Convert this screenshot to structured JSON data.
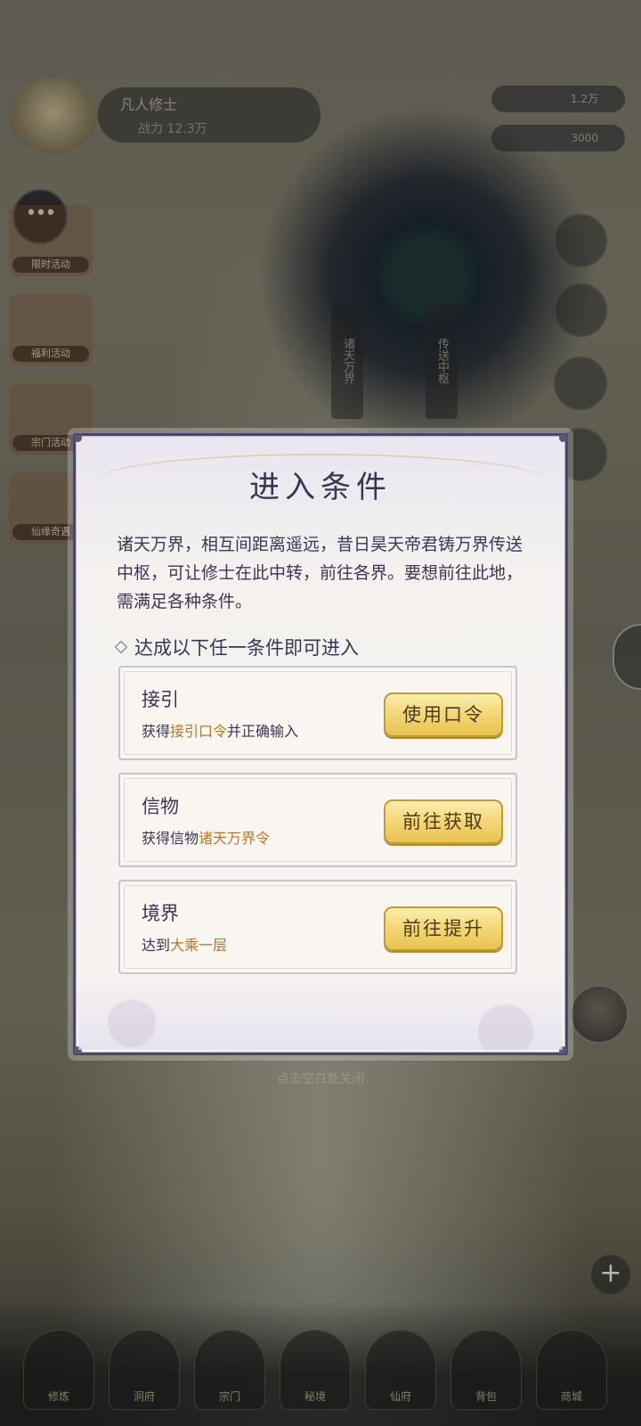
{
  "background": {
    "player": {
      "name": "凡人修士",
      "power": "战力 12.3万"
    },
    "resources": [
      {
        "value": "1.2万"
      },
      {
        "value": "3000"
      }
    ],
    "left_icons": [
      {
        "label": "限时活动"
      },
      {
        "label": "福利活动"
      },
      {
        "label": "宗门活动"
      },
      {
        "label": "仙缘奇遇"
      }
    ],
    "portal_signs": [
      "诸天万界",
      "传送中枢"
    ],
    "close_hint": "点击空白处关闭",
    "nav_labels": [
      "修炼",
      "洞府",
      "宗门",
      "秘境",
      "仙府",
      "背包",
      "商城"
    ]
  },
  "modal": {
    "title": "进入条件",
    "description": "诸天万界，相互间距离遥远，昔日昊天帝君铸万界传送中枢，可让修士在此中转，前往各界。要想前往此地，需满足各种条件。",
    "section_title": "达成以下任一条件即可进入",
    "conditions": [
      {
        "title": "接引",
        "desc_prefix": "获得",
        "desc_highlight": "接引口令",
        "desc_suffix": "并正确输入",
        "button": "使用口令"
      },
      {
        "title": "信物",
        "desc_prefix": "获得信物",
        "desc_highlight": "诸天万界令",
        "desc_suffix": "",
        "button": "前往获取"
      },
      {
        "title": "境界",
        "desc_prefix": "达到",
        "desc_highlight": "大乘一层",
        "desc_suffix": "",
        "button": "前往提升"
      }
    ]
  },
  "colors": {
    "highlight": "#b9742b",
    "title": "#3b3452",
    "button_gold": "#f4d879",
    "frame": "#4a4768"
  }
}
